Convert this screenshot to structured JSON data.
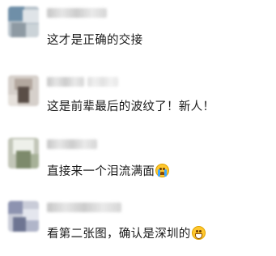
{
  "comments": [
    {
      "text": "这才是正确的交接",
      "emoji": null
    },
    {
      "text": "这是前辈最后的波纹了！新人！",
      "emoji": null
    },
    {
      "text": "直接来一个泪流满面",
      "emoji": "loudly-crying-face-icon"
    },
    {
      "text": "看第二张图，确认是深圳的",
      "emoji": "grinning-face-icon"
    }
  ]
}
